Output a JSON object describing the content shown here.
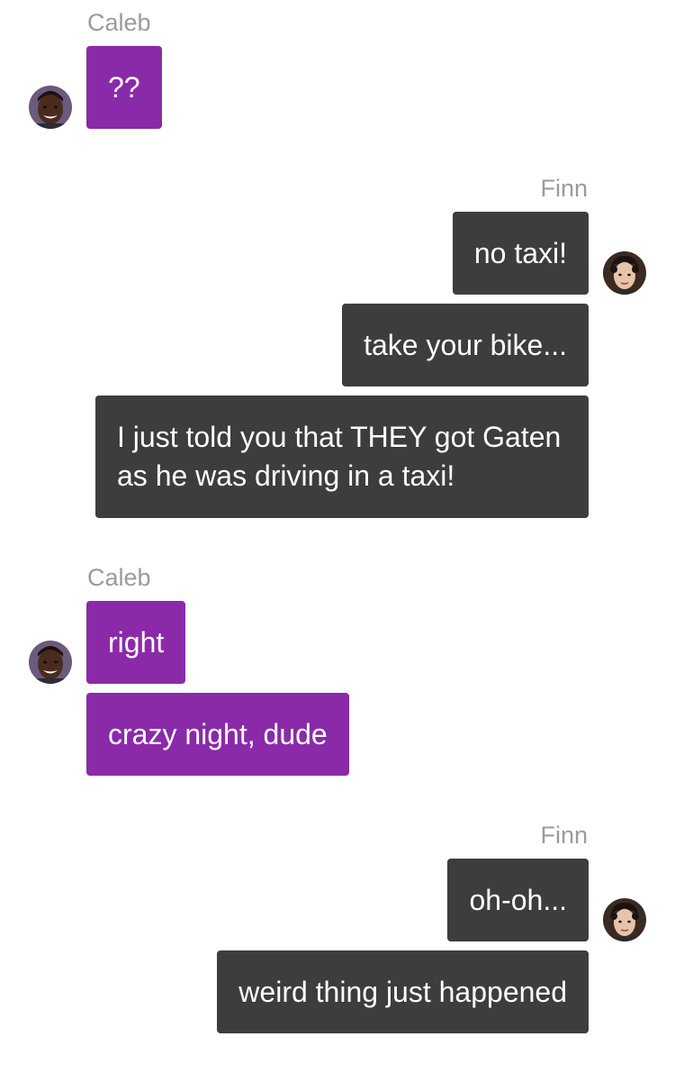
{
  "colors": {
    "left_bubble": "#8a2aa9",
    "right_bubble": "#3d3d3d",
    "sender_name": "#9b9b9b"
  },
  "groups": [
    {
      "side": "left",
      "sender": "Caleb",
      "avatar": "caleb-avatar-icon",
      "messages": [
        "??"
      ]
    },
    {
      "side": "right",
      "sender": "Finn",
      "avatar": "finn-avatar-icon",
      "messages": [
        "no taxi!",
        "take your bike...",
        "I just told you that THEY got Gaten as he was driving in a taxi!"
      ]
    },
    {
      "side": "left",
      "sender": "Caleb",
      "avatar": "caleb-avatar-icon",
      "messages": [
        "right",
        "crazy night, dude"
      ]
    },
    {
      "side": "right",
      "sender": "Finn",
      "avatar": "finn-avatar-icon",
      "messages": [
        "oh-oh...",
        "weird thing just happened"
      ]
    }
  ]
}
